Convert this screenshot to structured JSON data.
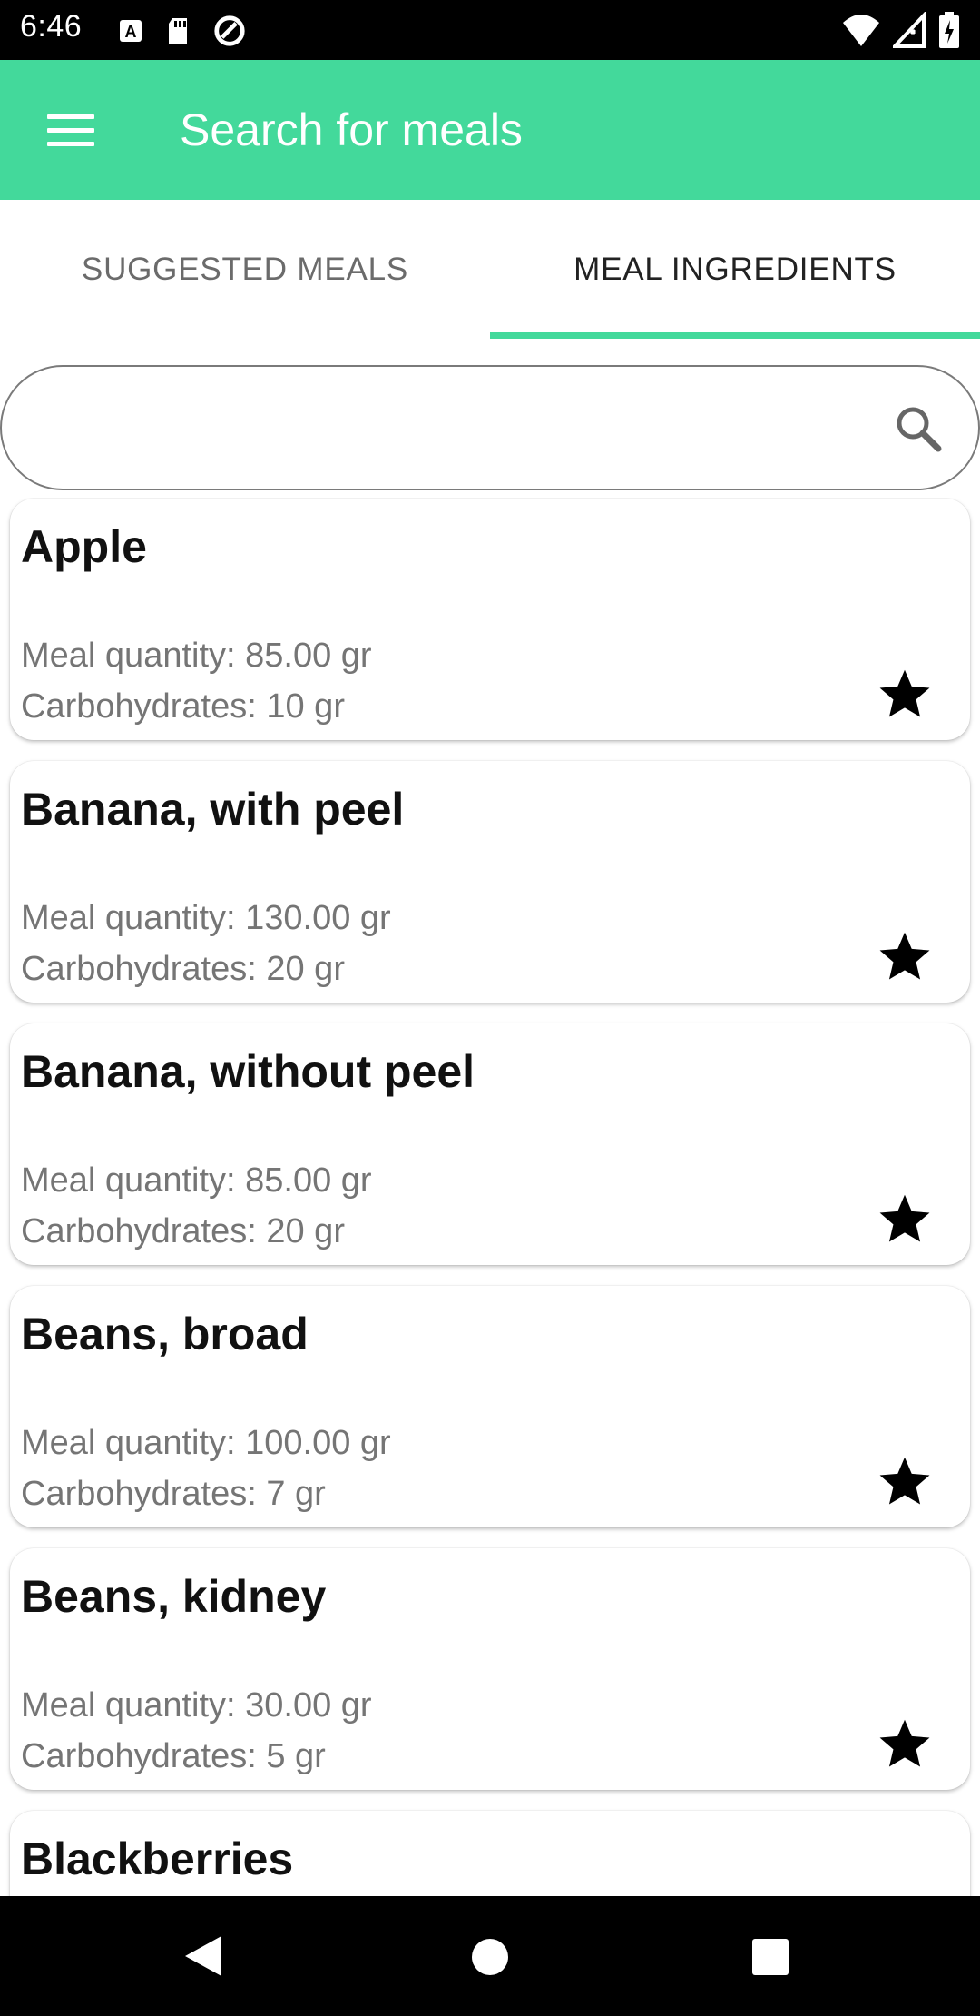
{
  "status_bar": {
    "time": "6:46",
    "left_icons": [
      "a-box-icon",
      "sd-card-icon",
      "data-saver-icon"
    ],
    "right_icons": [
      "wifi-icon",
      "cell-signal-icon",
      "battery-icon"
    ]
  },
  "app_bar": {
    "title": "Search for meals",
    "color": "#43d99b"
  },
  "tabs": [
    {
      "label": "SUGGESTED MEALS",
      "selected": false
    },
    {
      "label": "MEAL INGREDIENTS",
      "selected": true
    }
  ],
  "search": {
    "value": "",
    "placeholder": ""
  },
  "items": [
    {
      "name": "Apple",
      "quantity": "Meal quantity: 85.00 gr",
      "carbs": "Carbohydrates: 10 gr"
    },
    {
      "name": "Banana, with peel",
      "quantity": "Meal quantity: 130.00 gr",
      "carbs": "Carbohydrates: 20 gr"
    },
    {
      "name": "Banana, without peel",
      "quantity": "Meal quantity: 85.00 gr",
      "carbs": "Carbohydrates: 20 gr"
    },
    {
      "name": "Beans, broad",
      "quantity": "Meal quantity: 100.00 gr",
      "carbs": "Carbohydrates: 7 gr"
    },
    {
      "name": "Beans, kidney",
      "quantity": "Meal quantity: 30.00 gr",
      "carbs": "Carbohydrates: 5 gr"
    },
    {
      "name": "Blackberries",
      "quantity": "",
      "carbs": ""
    }
  ],
  "nav_bar": {
    "icons": [
      "back-icon",
      "home-icon",
      "recents-icon"
    ]
  }
}
